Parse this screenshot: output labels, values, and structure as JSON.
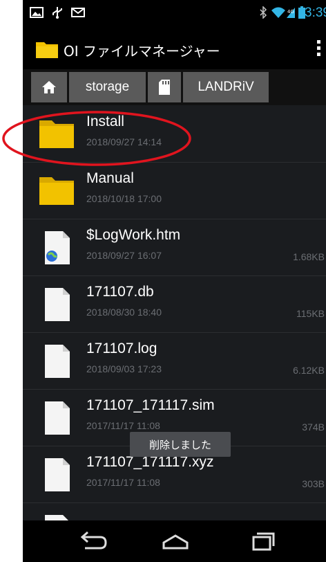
{
  "status_bar": {
    "time": "13:39",
    "icons": [
      "image-notification-icon",
      "usb-notification-icon",
      "mail-notification-icon",
      "bluetooth-icon",
      "wifi-icon",
      "signal-icon",
      "battery-icon"
    ]
  },
  "app_bar": {
    "title": "OI ファイルマネージャー",
    "menu_icon": "overflow-menu-icon"
  },
  "breadcrumb": {
    "items": [
      {
        "type": "icon",
        "icon": "home-icon"
      },
      {
        "type": "text",
        "label": "storage"
      },
      {
        "type": "icon",
        "icon": "sdcard-icon"
      },
      {
        "type": "text",
        "label": "LANDRiV"
      }
    ]
  },
  "files": [
    {
      "name": "Install",
      "date": "2018/09/27 14:14",
      "size": "",
      "icon": "folder-icon"
    },
    {
      "name": "Manual",
      "date": "2018/10/18 17:00",
      "size": "",
      "icon": "folder-icon"
    },
    {
      "name": "$LogWork.htm",
      "date": "2018/09/27 16:07",
      "size": "1.68KB",
      "icon": "html-file-icon"
    },
    {
      "name": "171107.db",
      "date": "2018/08/30 18:40",
      "size": "115KB",
      "icon": "file-icon"
    },
    {
      "name": "171107.log",
      "date": "2018/09/03 17:23",
      "size": "6.12KB",
      "icon": "file-icon"
    },
    {
      "name": "171107_171117.sim",
      "date": "2017/11/17 11:08",
      "size": "374B",
      "icon": "file-icon"
    },
    {
      "name": "171107_171117.xyz",
      "date": "2017/11/17 11:08",
      "size": "303B",
      "icon": "file-icon"
    }
  ],
  "toast": {
    "text": "削除しました"
  },
  "nav_bar": {
    "icons": [
      "back-icon",
      "home-nav-icon",
      "recent-apps-icon"
    ]
  },
  "annotation": {
    "color": "#e0141e"
  },
  "colors": {
    "accent": "#33b5e5",
    "folder": "#f2c200"
  }
}
